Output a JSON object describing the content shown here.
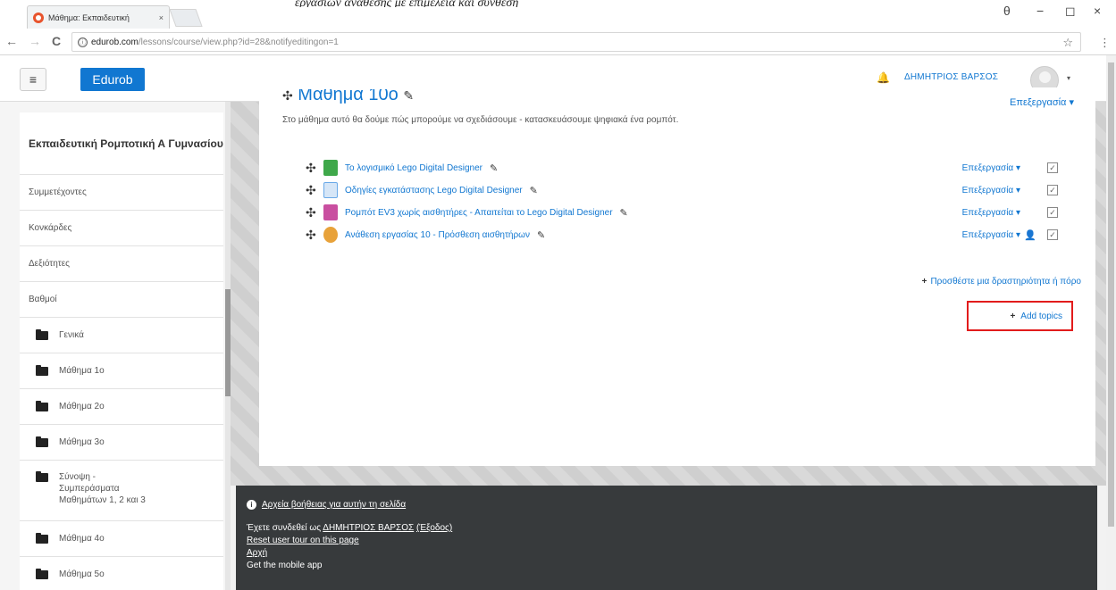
{
  "browser": {
    "tab_title": "Μάθημα: Εκπαιδευτική",
    "tab_close": "×",
    "url_domain": "edurob.com",
    "url_path": "/lessons/course/view.php?id=28&notifyeditingon=1",
    "info_icon": "ⓘ",
    "star_icon": "☆",
    "menu_icon": "⋮",
    "back_icon": "←",
    "forward_icon": "→",
    "reload_icon": "C",
    "account_icon": "θ",
    "minimize_icon": "−",
    "maximize_icon": "◻",
    "close_icon": "×"
  },
  "caption": "εργασιών ανάθεσης με επιμέλεια και σύνθεση",
  "navbar": {
    "menu_icon": "≡",
    "brand": "Edurob",
    "bell_icon": "🔔",
    "username": "ΔΗΜΗΤΡΙΟΣ ΒΑΡΣΟΣ",
    "caret": "▾"
  },
  "sidebar": {
    "course_title": "Εκπαιδευτική Ρομποτική Α Γυμνασίου",
    "items": [
      {
        "label": "Συμμετέχοντες"
      },
      {
        "label": "Κονκάρδες"
      },
      {
        "label": "Δεξιότητες"
      },
      {
        "label": "Βαθμοί"
      }
    ],
    "folders": [
      {
        "label": "Γενικά"
      },
      {
        "label": "Μάθημα 1ο"
      },
      {
        "label": "Μάθημα 2ο"
      },
      {
        "label": "Μάθημα 3ο"
      },
      {
        "label": "Σύνοψη - Συμπεράσματα Μαθημάτων 1, 2 και 3"
      },
      {
        "label": "Μάθημα 4ο"
      },
      {
        "label": "Μάθημα 5ο"
      }
    ]
  },
  "section": {
    "move_icon": "✣",
    "title": "Μάθημα 10ο",
    "pencil": "✎",
    "edit_label": "Επεξεργασία ▾",
    "summary": "Στο μάθημα αυτό θα δούμε πώς μπορούμε να σχεδιάσουμε - κατασκευάσουμε ψηφιακά ένα ρομπότ.",
    "activities": [
      {
        "name": "Το λογισμικό Lego Digital Designer",
        "edit": "Επεξεργασία ▾",
        "check": "☑",
        "color": "#3fa84a"
      },
      {
        "name": "Οδηγίες εγκατάστασης Lego Digital Designer",
        "edit": "Επεξεργασία ▾",
        "check": "☑",
        "color": "#6aa9e8"
      },
      {
        "name": "Ρομπότ EV3 χωρίς αισθητήρες - Απαιτείται το Lego Digital Designer",
        "edit": "Επεξεργασία ▾",
        "check": "☑",
        "color": "#c94fa0"
      },
      {
        "name": "Ανάθεση εργασίας 10 - Πρόσθεση αισθητήρων",
        "edit": "Επεξεργασία ▾",
        "check": "☑",
        "color": "#e8a23a",
        "role_icon": "👤"
      }
    ],
    "add_activity": "Προσθέστε μια δραστηριότητα ή πόρο",
    "add_topics": "Add topics",
    "plus": "+"
  },
  "footer": {
    "help_icon": "i",
    "help_link": "Αρχεία βοήθειας για αυτήν τη σελίδα",
    "logged_prefix": "Έχετε συνδεθεί ως ",
    "logged_user": "ΔΗΜΗΤΡΙΟΣ ΒΑΡΣΟΣ",
    "logout": "(Έξοδος)",
    "reset_tour": "Reset user tour on this page",
    "home": "Αρχή",
    "mobile_app": "Get the mobile app"
  },
  "colors": {
    "accent": "#1177d1",
    "highlight_box": "#e21c1c",
    "footer_bg": "#373a3c"
  }
}
